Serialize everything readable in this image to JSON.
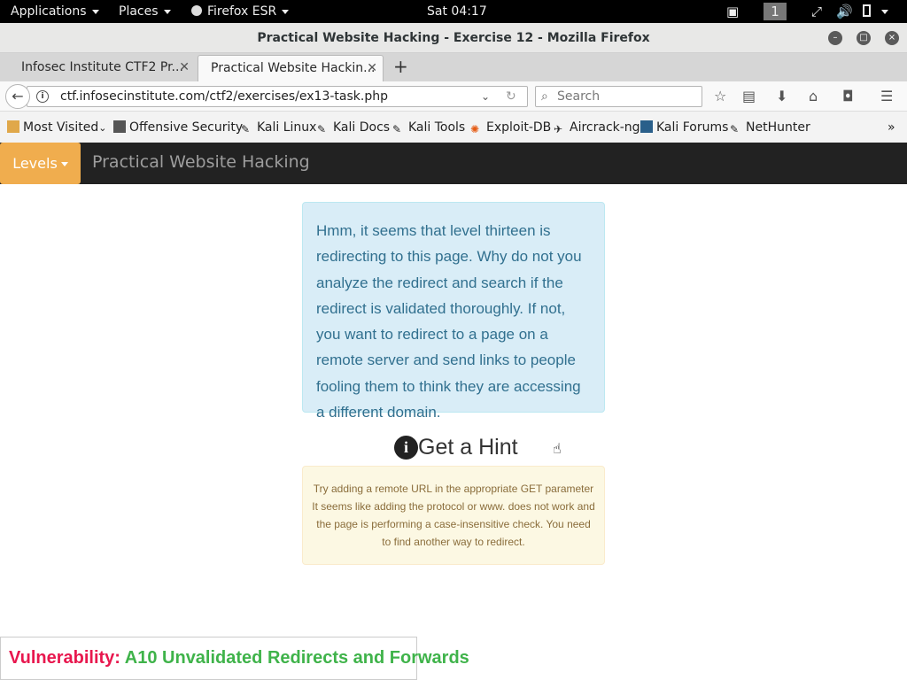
{
  "topbar": {
    "applications": "Applications",
    "places": "Places",
    "firefox": "Firefox ESR",
    "clock": "Sat 04:17",
    "workspace": "1"
  },
  "window": {
    "title": "Practical Website Hacking - Exercise 12 - Mozilla Firefox"
  },
  "tabs": [
    {
      "label": "Infosec Institute CTF2 Pr..."
    },
    {
      "label": "Practical Website Hackin..."
    }
  ],
  "navbar": {
    "url": "ctf.infosecinstitute.com/ctf2/exercises/ex13-task.php",
    "search_placeholder": "Search"
  },
  "bookmarks": [
    {
      "label": "Most Visited",
      "icon": "folder-icon"
    },
    {
      "label": "Offensive Security",
      "icon": "offsec-icon"
    },
    {
      "label": "Kali Linux",
      "icon": "kali-icon"
    },
    {
      "label": "Kali Docs",
      "icon": "kali-icon"
    },
    {
      "label": "Kali Tools",
      "icon": "kali-icon"
    },
    {
      "label": "Exploit-DB",
      "icon": "exploitdb-icon"
    },
    {
      "label": "Aircrack-ng",
      "icon": "aircrack-icon"
    },
    {
      "label": "Kali Forums",
      "icon": "kali-forums-icon"
    },
    {
      "label": "NetHunter",
      "icon": "kali-icon"
    }
  ],
  "page": {
    "levels_button": "Levels",
    "brand": "Practical Website Hacking",
    "info_text": "Hmm, it seems that level thirteen is redirecting to this page. Why do not you analyze the redirect and search if the redirect is validated thoroughly. If not, you want to redirect to a page on a remote server and send links to people fooling them to think they are accessing a different domain.",
    "hint_title": "Get a Hint",
    "hint_text": "Try adding a remote URL in the appropriate GET parameter It seems like adding the protocol or www. does not work and the page is performing a case-insensitive check. You need to find another way to redirect.",
    "vulnerability_label": "Vulnerability:",
    "vulnerability_value": "A10 Unvalidated Redirects and Forwards"
  },
  "colors": {
    "levels_bg": "#f0ad4e",
    "info_bg": "#d9edf7",
    "warning_bg": "#fcf8e3",
    "vuln_label": "#e8174e",
    "vuln_value": "#3fb34a"
  }
}
